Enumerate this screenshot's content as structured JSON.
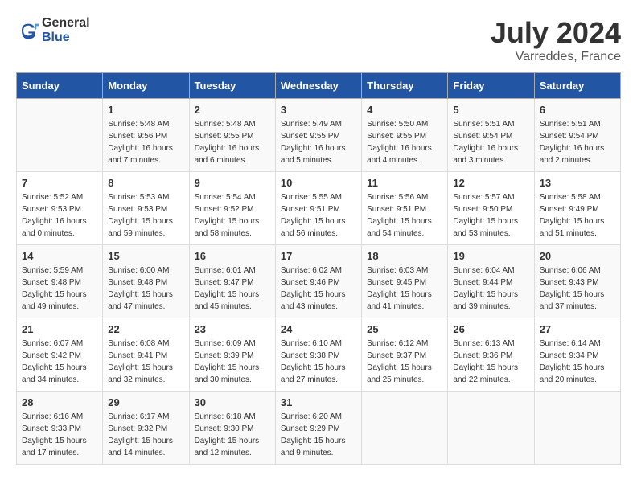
{
  "header": {
    "logo_general": "General",
    "logo_blue": "Blue",
    "month_year": "July 2024",
    "location": "Varreddes, France"
  },
  "weekdays": [
    "Sunday",
    "Monday",
    "Tuesday",
    "Wednesday",
    "Thursday",
    "Friday",
    "Saturday"
  ],
  "weeks": [
    [
      {
        "day": "",
        "info": ""
      },
      {
        "day": "1",
        "info": "Sunrise: 5:48 AM\nSunset: 9:56 PM\nDaylight: 16 hours\nand 7 minutes."
      },
      {
        "day": "2",
        "info": "Sunrise: 5:48 AM\nSunset: 9:55 PM\nDaylight: 16 hours\nand 6 minutes."
      },
      {
        "day": "3",
        "info": "Sunrise: 5:49 AM\nSunset: 9:55 PM\nDaylight: 16 hours\nand 5 minutes."
      },
      {
        "day": "4",
        "info": "Sunrise: 5:50 AM\nSunset: 9:55 PM\nDaylight: 16 hours\nand 4 minutes."
      },
      {
        "day": "5",
        "info": "Sunrise: 5:51 AM\nSunset: 9:54 PM\nDaylight: 16 hours\nand 3 minutes."
      },
      {
        "day": "6",
        "info": "Sunrise: 5:51 AM\nSunset: 9:54 PM\nDaylight: 16 hours\nand 2 minutes."
      }
    ],
    [
      {
        "day": "7",
        "info": "Sunrise: 5:52 AM\nSunset: 9:53 PM\nDaylight: 16 hours\nand 0 minutes."
      },
      {
        "day": "8",
        "info": "Sunrise: 5:53 AM\nSunset: 9:53 PM\nDaylight: 15 hours\nand 59 minutes."
      },
      {
        "day": "9",
        "info": "Sunrise: 5:54 AM\nSunset: 9:52 PM\nDaylight: 15 hours\nand 58 minutes."
      },
      {
        "day": "10",
        "info": "Sunrise: 5:55 AM\nSunset: 9:51 PM\nDaylight: 15 hours\nand 56 minutes."
      },
      {
        "day": "11",
        "info": "Sunrise: 5:56 AM\nSunset: 9:51 PM\nDaylight: 15 hours\nand 54 minutes."
      },
      {
        "day": "12",
        "info": "Sunrise: 5:57 AM\nSunset: 9:50 PM\nDaylight: 15 hours\nand 53 minutes."
      },
      {
        "day": "13",
        "info": "Sunrise: 5:58 AM\nSunset: 9:49 PM\nDaylight: 15 hours\nand 51 minutes."
      }
    ],
    [
      {
        "day": "14",
        "info": "Sunrise: 5:59 AM\nSunset: 9:48 PM\nDaylight: 15 hours\nand 49 minutes."
      },
      {
        "day": "15",
        "info": "Sunrise: 6:00 AM\nSunset: 9:48 PM\nDaylight: 15 hours\nand 47 minutes."
      },
      {
        "day": "16",
        "info": "Sunrise: 6:01 AM\nSunset: 9:47 PM\nDaylight: 15 hours\nand 45 minutes."
      },
      {
        "day": "17",
        "info": "Sunrise: 6:02 AM\nSunset: 9:46 PM\nDaylight: 15 hours\nand 43 minutes."
      },
      {
        "day": "18",
        "info": "Sunrise: 6:03 AM\nSunset: 9:45 PM\nDaylight: 15 hours\nand 41 minutes."
      },
      {
        "day": "19",
        "info": "Sunrise: 6:04 AM\nSunset: 9:44 PM\nDaylight: 15 hours\nand 39 minutes."
      },
      {
        "day": "20",
        "info": "Sunrise: 6:06 AM\nSunset: 9:43 PM\nDaylight: 15 hours\nand 37 minutes."
      }
    ],
    [
      {
        "day": "21",
        "info": "Sunrise: 6:07 AM\nSunset: 9:42 PM\nDaylight: 15 hours\nand 34 minutes."
      },
      {
        "day": "22",
        "info": "Sunrise: 6:08 AM\nSunset: 9:41 PM\nDaylight: 15 hours\nand 32 minutes."
      },
      {
        "day": "23",
        "info": "Sunrise: 6:09 AM\nSunset: 9:39 PM\nDaylight: 15 hours\nand 30 minutes."
      },
      {
        "day": "24",
        "info": "Sunrise: 6:10 AM\nSunset: 9:38 PM\nDaylight: 15 hours\nand 27 minutes."
      },
      {
        "day": "25",
        "info": "Sunrise: 6:12 AM\nSunset: 9:37 PM\nDaylight: 15 hours\nand 25 minutes."
      },
      {
        "day": "26",
        "info": "Sunrise: 6:13 AM\nSunset: 9:36 PM\nDaylight: 15 hours\nand 22 minutes."
      },
      {
        "day": "27",
        "info": "Sunrise: 6:14 AM\nSunset: 9:34 PM\nDaylight: 15 hours\nand 20 minutes."
      }
    ],
    [
      {
        "day": "28",
        "info": "Sunrise: 6:16 AM\nSunset: 9:33 PM\nDaylight: 15 hours\nand 17 minutes."
      },
      {
        "day": "29",
        "info": "Sunrise: 6:17 AM\nSunset: 9:32 PM\nDaylight: 15 hours\nand 14 minutes."
      },
      {
        "day": "30",
        "info": "Sunrise: 6:18 AM\nSunset: 9:30 PM\nDaylight: 15 hours\nand 12 minutes."
      },
      {
        "day": "31",
        "info": "Sunrise: 6:20 AM\nSunset: 9:29 PM\nDaylight: 15 hours\nand 9 minutes."
      },
      {
        "day": "",
        "info": ""
      },
      {
        "day": "",
        "info": ""
      },
      {
        "day": "",
        "info": ""
      }
    ]
  ]
}
